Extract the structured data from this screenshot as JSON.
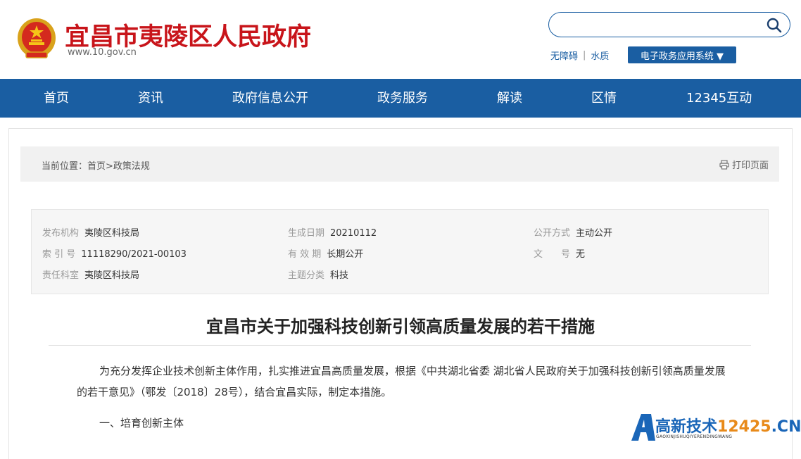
{
  "header": {
    "site_title": "宜昌市夷陵区人民政府",
    "site_url": "www.10.gov.cn",
    "search_placeholder": "",
    "links": [
      "无障碍",
      "水质"
    ],
    "system_button": "电子政务应用系统 ▼"
  },
  "nav": {
    "items": [
      "首页",
      "资讯",
      "政府信息公开",
      "政务服务",
      "解读",
      "区情",
      "12345互动"
    ]
  },
  "breadcrumb": {
    "text": "当前位置：首页>政策法规",
    "print_label": "打印页面"
  },
  "meta": {
    "publisher_key": "发布机构",
    "publisher": "夷陵区科技局",
    "date_key": "生成日期",
    "date": "20210112",
    "open_mode_key": "公开方式",
    "open_mode": "主动公开",
    "index_key": "索 引 号",
    "index": "11118290/2021-00103",
    "validity_key": "有 效 期",
    "validity": "长期公开",
    "doc_no_key": "文　　号",
    "doc_no": "无",
    "responsible_key": "责任科室",
    "responsible": "夷陵区科技局",
    "topic_key": "主题分类",
    "topic": "科技"
  },
  "article": {
    "title": "宜昌市关于加强科技创新引领高质量发展的若干措施",
    "intro": "为充分发挥企业技术创新主体作用，扎实推进宜昌高质量发展，根据《中共湖北省委 湖北省人民政府关于加强科技创新引领高质量发展的若干意见》（鄂发〔2018〕28号），结合宜昌实际，制定本措施。",
    "section1": "一、培育创新主体"
  },
  "watermark": {
    "name": "高新技术",
    "num": "12425",
    "suffix": ".CN",
    "sub": "GAOXINJISHUQIYERENDINGWANG"
  },
  "colors": {
    "brand_red": "#c8141a",
    "brand_blue": "#1a5ea2"
  }
}
